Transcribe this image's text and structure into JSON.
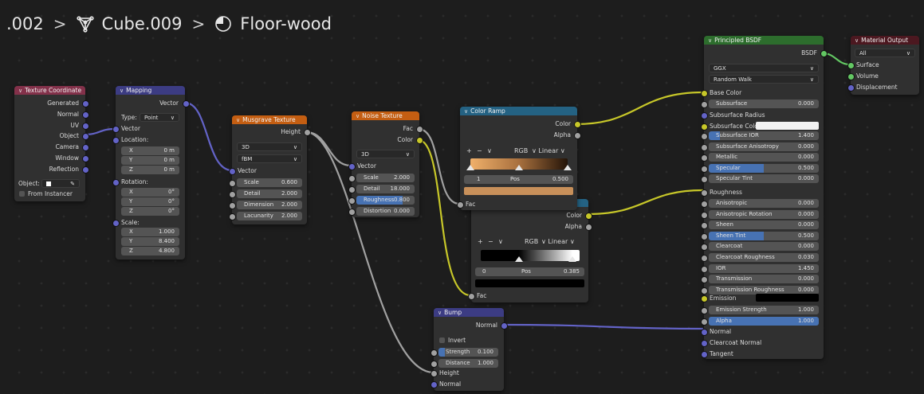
{
  "breadcrumb": {
    "object": ".002",
    "mesh": "Cube.009",
    "material": "Floor-wood",
    "sep": ">"
  },
  "colors": {
    "vector_socket": "#6363c7",
    "float_socket": "#a1a1a1",
    "color_socket": "#c7c729",
    "shader_socket": "#63c763",
    "input_header": "#83314a",
    "vector_header": "#3c3c83",
    "texture_header": "#e66e00",
    "converter_header": "#246283",
    "shader_header": "#2d6d2d",
    "output_header": "#4c1820",
    "selection_blue": "#4772b3"
  },
  "icons": {
    "mesh": "mesh-data-icon",
    "material": "material-sphere-icon",
    "eyedropper": "eyedropper-icon"
  },
  "texcoord": {
    "title": "Texture Coordinate",
    "outputs": [
      "Generated",
      "Normal",
      "UV",
      "Object",
      "Camera",
      "Window",
      "Reflection"
    ],
    "object_label": "Object:",
    "from_instancer": "From Instancer"
  },
  "mapping": {
    "title": "Mapping",
    "output": "Vector",
    "type_label": "Type:",
    "type_value": "Point",
    "vector": "Vector",
    "location_label": "Location:",
    "location": [
      {
        "axis": "X",
        "value": "0 m"
      },
      {
        "axis": "Y",
        "value": "0 m"
      },
      {
        "axis": "Z",
        "value": "0 m"
      }
    ],
    "rotation_label": "Rotation:",
    "rotation": [
      {
        "axis": "X",
        "value": "0°"
      },
      {
        "axis": "Y",
        "value": "0°"
      },
      {
        "axis": "Z",
        "value": "0°"
      }
    ],
    "scale_label": "Scale:",
    "scale": [
      {
        "axis": "X",
        "value": "1.000"
      },
      {
        "axis": "Y",
        "value": "8.400"
      },
      {
        "axis": "Z",
        "value": "4.800"
      }
    ]
  },
  "musgrave": {
    "title": "Musgrave Texture",
    "output": "Height",
    "dimensions": "3D",
    "type": "fBM",
    "vector": "Vector",
    "fields": [
      {
        "label": "Scale",
        "value": "0.600"
      },
      {
        "label": "Detail",
        "value": "2.000"
      },
      {
        "label": "Dimension",
        "value": "2.000"
      },
      {
        "label": "Lacunarity",
        "value": "2.000"
      }
    ]
  },
  "noise": {
    "title": "Noise Texture",
    "outputs": [
      "Fac",
      "Color"
    ],
    "dimensions": "3D",
    "vector": "Vector",
    "fields": [
      {
        "label": "Scale",
        "value": "2.000"
      },
      {
        "label": "Detail",
        "value": "18.000"
      },
      {
        "label": "Roughness",
        "value": "0.800"
      },
      {
        "label": "Distortion",
        "value": "0.000"
      }
    ],
    "roughness_fill": 0.8
  },
  "ramp1": {
    "title": "Color Ramp",
    "outputs": [
      "Color",
      "Alpha"
    ],
    "add": "+",
    "remove": "−",
    "menu": "∨",
    "color_mode": "RGB",
    "interpolation": "Linear",
    "index": "1",
    "pos_label": "Pos",
    "pos_value": "0.500",
    "input": "Fac",
    "swatch": "#c8905a",
    "stops": [
      0.0,
      0.5,
      1.0
    ]
  },
  "ramp2": {
    "outputs": [
      "Color",
      "Alpha"
    ],
    "add": "+",
    "remove": "−",
    "menu": "∨",
    "color_mode": "RGB",
    "interpolation": "Linear",
    "index": "0",
    "pos_label": "Pos",
    "pos_value": "0.385",
    "input": "Fac",
    "swatch": "#000000",
    "stops": [
      0.385,
      0.93
    ]
  },
  "bump": {
    "title": "Bump",
    "output": "Normal",
    "invert": "Invert",
    "fields": [
      {
        "label": "Strength",
        "value": "0.100"
      },
      {
        "label": "Distance",
        "value": "1.000"
      }
    ],
    "inputs": [
      "Height",
      "Normal"
    ],
    "strength_fill": 0.1
  },
  "bsdf": {
    "title": "Principled BSDF",
    "output": "BSDF",
    "distribution": "GGX",
    "subsurface_method": "Random Walk",
    "base_color": "Base Color",
    "subsurface": {
      "label": "Subsurface",
      "value": "0.000"
    },
    "subsurface_radius": "Subsurface Radius",
    "subsurface_color": "Subsurface Color",
    "fields1": [
      {
        "label": "Subsurface IOR",
        "value": "1.400"
      },
      {
        "label": "Subsurface Anisotropy",
        "value": "0.000"
      },
      {
        "label": "Metallic",
        "value": "0.000"
      },
      {
        "label": "Specular",
        "value": "0.500"
      },
      {
        "label": "Specular Tint",
        "value": "0.000"
      }
    ],
    "roughness": "Roughness",
    "fields2": [
      {
        "label": "Anisotropic",
        "value": "0.000"
      },
      {
        "label": "Anisotropic Rotation",
        "value": "0.000"
      },
      {
        "label": "Sheen",
        "value": "0.000"
      },
      {
        "label": "Sheen Tint",
        "value": "0.500"
      },
      {
        "label": "Clearcoat",
        "value": "0.000"
      },
      {
        "label": "Clearcoat Roughness",
        "value": "0.030"
      },
      {
        "label": "IOR",
        "value": "1.450"
      },
      {
        "label": "Transmission",
        "value": "0.000"
      },
      {
        "label": "Transmission Roughness",
        "value": "0.000"
      }
    ],
    "emission": "Emission",
    "emission_color": "#000000",
    "subsurface_color_value": "#f2f2f2",
    "emission_strength": {
      "label": "Emission Strength",
      "value": "1.000"
    },
    "alpha": {
      "label": "Alpha",
      "value": "1.000"
    },
    "inputs_end": [
      "Normal",
      "Clearcoat Normal",
      "Tangent"
    ],
    "fills": {
      "Subsurface IOR": 0.1,
      "Specular": 0.5,
      "Sheen Tint": 0.5
    }
  },
  "output": {
    "title": "Material Output",
    "target": "All",
    "inputs": [
      "Surface",
      "Volume",
      "Displacement"
    ]
  }
}
